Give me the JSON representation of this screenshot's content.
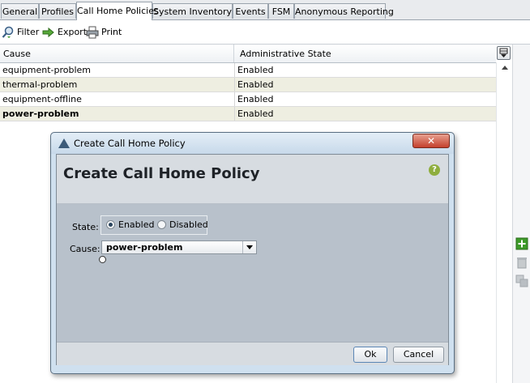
{
  "tabs": [
    "General",
    "Profiles",
    "Call Home Policies",
    "System Inventory",
    "Events",
    "FSM",
    "Anonymous Reporting"
  ],
  "active_tab": "Call Home Policies",
  "toolbar": {
    "filter": "Filter",
    "export": "Export",
    "print": "Print"
  },
  "table": {
    "columns": [
      "Cause",
      "Administrative State"
    ],
    "rows": [
      {
        "cause": "equipment-problem",
        "state": "Enabled"
      },
      {
        "cause": "thermal-problem",
        "state": "Enabled"
      },
      {
        "cause": "equipment-offline",
        "state": "Enabled"
      },
      {
        "cause": "power-problem",
        "state": "Enabled"
      }
    ]
  },
  "dialog": {
    "window_title": "Create Call Home Policy",
    "heading": "Create Call Home Policy",
    "help": "?",
    "state_label": "State:",
    "state_options": [
      "Enabled",
      "Disabled"
    ],
    "state_selected": "Enabled",
    "cause_label": "Cause:",
    "cause_value": "power-problem",
    "ok": "Ok",
    "cancel": "Cancel",
    "close": "✕"
  },
  "colors": {
    "alt_row": "#eeeee1",
    "dialog_frame": "#cfe0ef",
    "dialog_body": "#b8c1cb",
    "help_badge": "#8fae3e",
    "add_icon": "#3c9a28"
  }
}
